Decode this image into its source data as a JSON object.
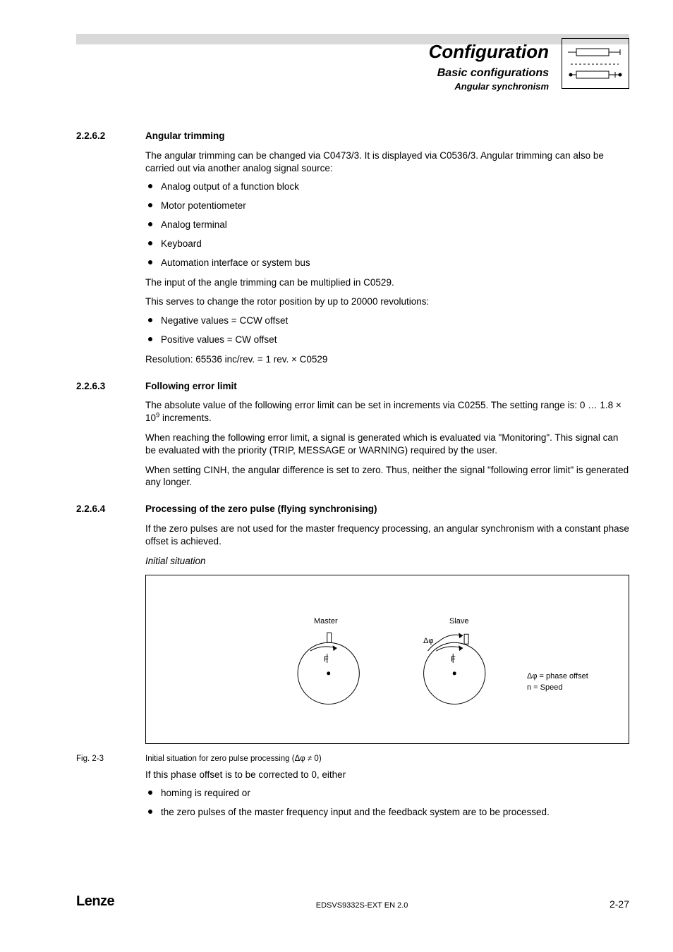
{
  "header": {
    "main": "Configuration",
    "sub1": "Basic configurations",
    "sub2": "Angular synchronism"
  },
  "sec1": {
    "num": "2.2.6.2",
    "title": "Angular trimming",
    "p1": "The angular trimming can be changed via C0473/3. It is displayed via C0536/3. Angular trimming can also be carried out via another analog signal source:",
    "b1": "Analog output of a function block",
    "b2": "Motor potentiometer",
    "b3": "Analog terminal",
    "b4": "Keyboard",
    "b5": "Automation interface or system bus",
    "p2": "The input of the angle trimming can be multiplied in C0529.",
    "p3": "This serves to change the rotor position by up to 20000 revolutions:",
    "b6": "Negative values = CCW offset",
    "b7": "Positive values =  CW offset",
    "p4": "Resolution: 65536 inc/rev. = 1 rev. × C0529"
  },
  "sec2": {
    "num": "2.2.6.3",
    "title": "Following error limit",
    "p1a": "The absolute value of the following error limit can be set in increments via C0255. The setting range is: 0 … 1.8 × 10",
    "p1b": " increments.",
    "p2": "When reaching the following error limit, a signal is generated which is evaluated via \"Monitoring\". This signal can be evaluated with the priority (TRIP, MESSAGE or WARNING) required by the user.",
    "p3": "When setting CINH, the angular difference is set to zero. Thus, neither the signal \"following error limit\" is generated any longer."
  },
  "sec3": {
    "num": "2.2.6.4",
    "title": "Processing of the zero pulse (flying synchronising)",
    "p1": "If the zero pulses are not used for the master frequency processing, an angular synchronism with a constant phase offset is achieved.",
    "sub": "Initial situation",
    "fig": {
      "master": "Master",
      "slave": "Slave",
      "F": "F",
      "dphi": "Δφ",
      "legend1": "Δφ = phase offset",
      "legend2": "n = Speed"
    },
    "fignum": "Fig. 2-3",
    "figcap": "Initial situation for zero pulse processing (Δφ ≠ 0)",
    "p2": "If this phase offset is to be corrected to 0, either",
    "b1": "homing is required or",
    "b2": "the zero pulses of the master frequency input and the feedback system are to be processed."
  },
  "footer": {
    "brand": "Lenze",
    "docid": "EDSVS9332S-EXT EN 2.0",
    "page": "2-27"
  }
}
